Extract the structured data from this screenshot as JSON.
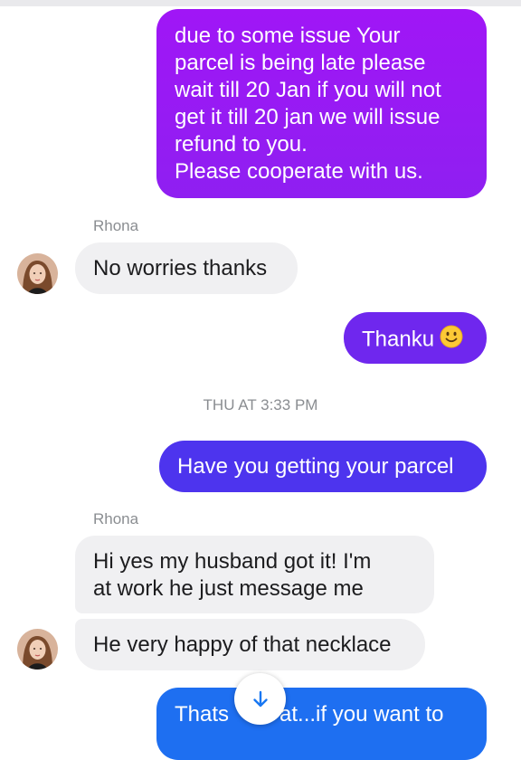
{
  "messages": {
    "m1": {
      "lines": "due to some issue Your\nparcel is being late please\nwait till 20 Jan if you will not\nget it till 20 jan we will issue\nrefund to you.\nPlease cooperate with us."
    },
    "sender1": "Rhona",
    "m2": "No worries thanks",
    "m3": {
      "text": "Thanku",
      "emoji": "smiley-emoji"
    },
    "timestamp": "THU AT 3:33 PM",
    "m4": "Have you getting your parcel",
    "sender2": "Rhona",
    "m5": "Hi  yes my husband got it! I'm\nat work he just message me",
    "m6": "He very happy of that necklace",
    "m7": {
      "visible_start": "Thats",
      "visible_end": "at...if you want to"
    }
  },
  "icons": {
    "scroll_down": "arrow-down-icon",
    "avatar": "contact-avatar"
  },
  "colors": {
    "outgoing_purple": "#9d1cf2",
    "outgoing_indigo": "#5a2df0",
    "outgoing_blue": "#1e6ff1",
    "incoming_gray": "#f0f0f2",
    "meta_gray": "#8a8d91"
  }
}
